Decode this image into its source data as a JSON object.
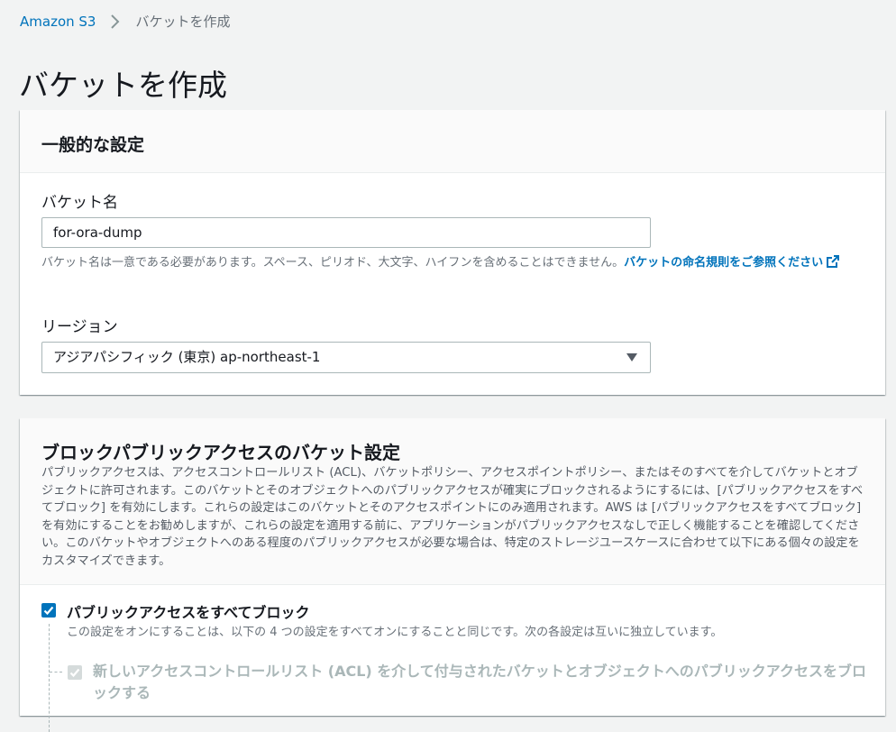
{
  "breadcrumb": {
    "root": "Amazon S3",
    "current": "バケットを作成"
  },
  "page": {
    "title": "バケットを作成"
  },
  "general": {
    "heading": "一般的な設定",
    "bucket_name_label": "バケット名",
    "bucket_name_value": "for-ora-dump",
    "bucket_name_hint": "バケット名は一意である必要があります。スペース、ピリオド、大文字、ハイフンを含めることはできません。",
    "naming_rules_link": "バケットの命名規則をご参照ください",
    "region_label": "リージョン",
    "region_value": "アジアパシフィック (東京) ap-northeast-1"
  },
  "public_access": {
    "heading": "ブロックパブリックアクセスのバケット設定",
    "description": "パブリックアクセスは、アクセスコントロールリスト (ACL)、バケットポリシー、アクセスポイントポリシー、またはそのすべてを介してバケットとオブジェクトに許可されます。このバケットとそのオブジェクトへのパブリックアクセスが確実にブロックされるようにするには、[パブリックアクセスをすべてブロック] を有効にします。これらの設定はこのバケットとそのアクセスポイントにのみ適用されます。AWS は [パブリックアクセスをすべてブロック] を有効にすることをお勧めしますが、これらの設定を適用する前に、アプリケーションがパブリックアクセスなしで正しく機能することを確認してください。このバケットやオブジェクトへのある程度のパブリックアクセスが必要な場合は、特定のストレージユースケースに合わせて以下にある個々の設定をカスタマイズできます。",
    "block_all_label": "パブリックアクセスをすべてブロック",
    "block_all_desc": "この設定をオンにすることは、以下の 4 つの設定をすべてオンにすることと同じです。次の各設定は互いに独立しています。",
    "block_acl_label": "新しいアクセスコントロールリスト (ACL) を介して付与されたバケットとオブジェクトへのパブリックアクセスをブロックする",
    "block_all_checked": true,
    "block_acl_checked": true
  },
  "colors": {
    "link": "#0073bb",
    "checkbox_checked": "#0073bb",
    "checkbox_disabled": "#d5dbdb"
  }
}
